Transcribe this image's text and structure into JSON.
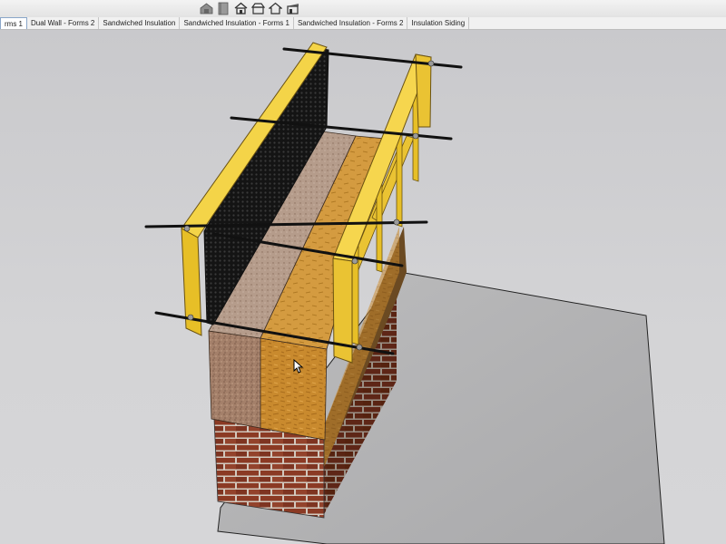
{
  "toolbar": {
    "icons": [
      "warehouse-icon",
      "book-icon",
      "house-icon",
      "barn-icon",
      "house-outline-icon",
      "shed-icon"
    ]
  },
  "tabs": [
    {
      "label": "rms 1",
      "active": true
    },
    {
      "label": "Dual Wall - Forms 2",
      "active": false
    },
    {
      "label": "Sandwiched Insulation",
      "active": false
    },
    {
      "label": "Sandwiched Insulation - Forms 1",
      "active": false
    },
    {
      "label": "Sandwiched Insulation - Forms 2",
      "active": false
    },
    {
      "label": "Insulation Siding",
      "active": false
    }
  ],
  "colors": {
    "viewport_bg": "#cfcfd1",
    "formwork_yellow": "#f0c83a",
    "rigid_insulation": "#c98a32",
    "aggregate": "#a88062",
    "brick": "#8c3a25",
    "concrete_slab": "#b4b4b6"
  }
}
